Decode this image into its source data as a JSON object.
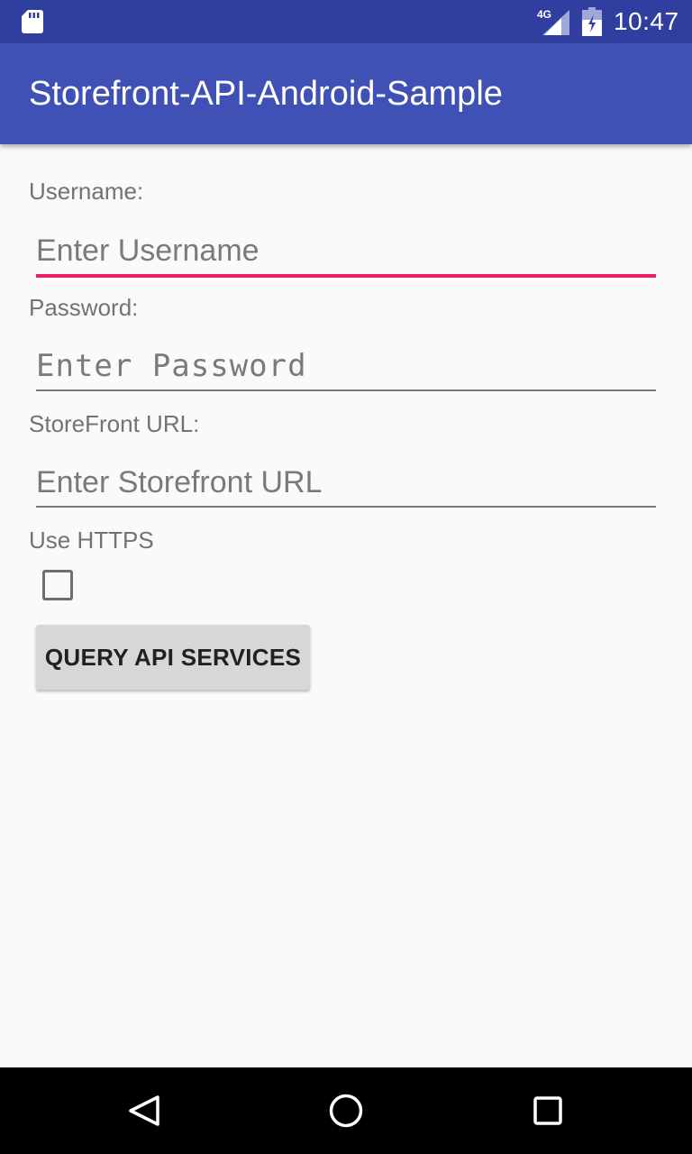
{
  "status_bar": {
    "network_label": "4G",
    "time": "10:47",
    "icons": [
      "sd-card-icon",
      "signal-icon",
      "battery-icon"
    ]
  },
  "app_bar": {
    "title": "Storefront-API-Android-Sample",
    "color": "#3f51b5",
    "status_color": "#303f9f"
  },
  "form": {
    "username": {
      "label": "Username:",
      "placeholder": "Enter Username",
      "value": "",
      "focused": true
    },
    "password": {
      "label": "Password:",
      "placeholder": "Enter Password",
      "value": ""
    },
    "storefront_url": {
      "label": "StoreFront URL:",
      "placeholder": "Enter Storefront URL",
      "value": ""
    },
    "use_https": {
      "label": "Use HTTPS",
      "checked": false
    },
    "query_button": {
      "label": "QUERY API SERVICES"
    }
  },
  "accent_color": "#e91e63",
  "nav_bar": {
    "icons": [
      "back-icon",
      "home-icon",
      "recents-icon"
    ]
  }
}
